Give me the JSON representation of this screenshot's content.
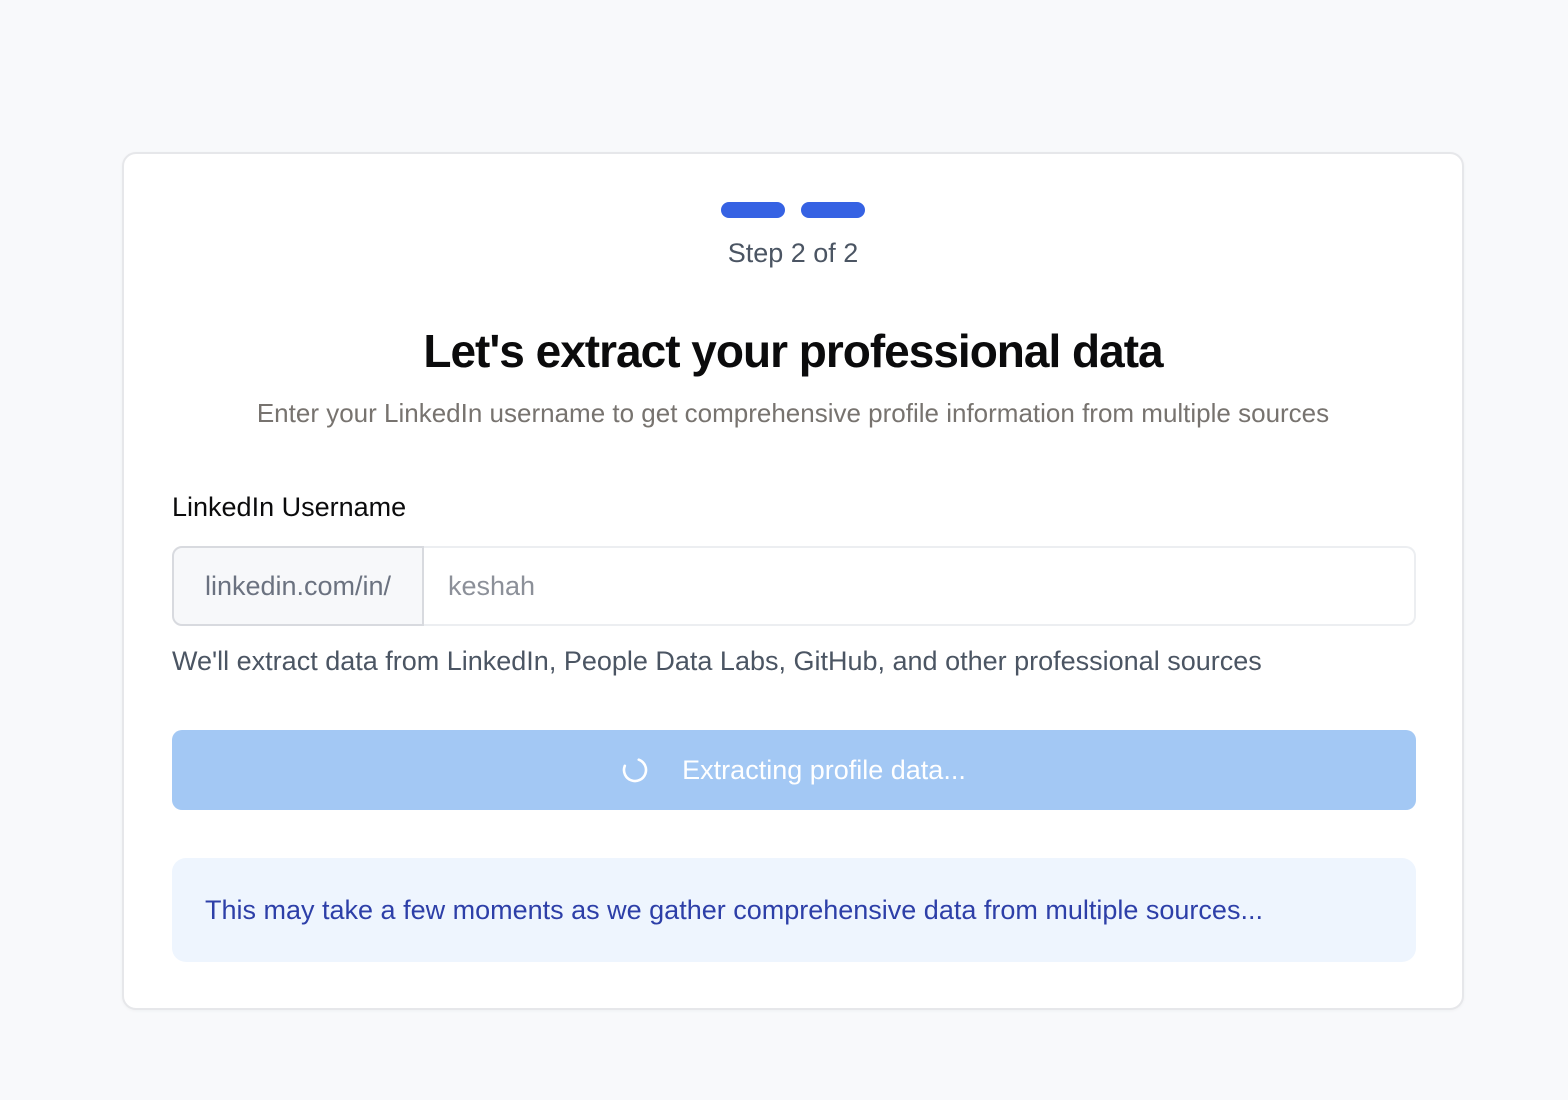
{
  "step": {
    "label": "Step 2 of 2",
    "current": 2,
    "total": 2,
    "active_color": "#3662e3"
  },
  "header": {
    "title": "Let's extract your professional data",
    "subtitle": "Enter your LinkedIn username to get comprehensive profile information from multiple sources"
  },
  "form": {
    "field_label": "LinkedIn Username",
    "prefix": "linkedin.com/in/",
    "input_value": "",
    "input_placeholder": "keshah",
    "help_text": "We'll extract data from LinkedIn, People Data Labs, GitHub, and other professional sources"
  },
  "submit": {
    "label": "Extracting profile data...",
    "icon": "spinner-icon",
    "state": "loading",
    "color": "#a3c8f4"
  },
  "notice": {
    "text": "This may take a few moments as we gather comprehensive data from multiple sources..."
  }
}
